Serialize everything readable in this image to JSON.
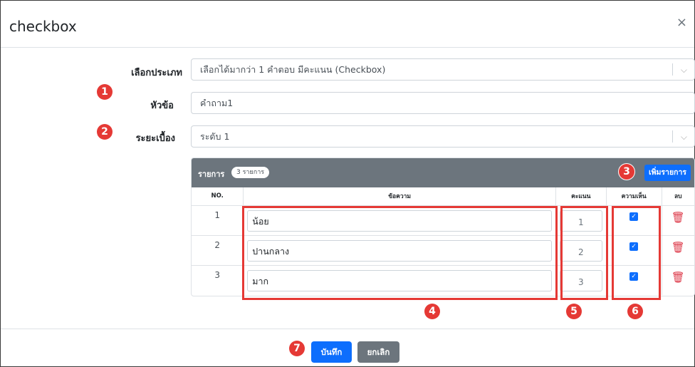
{
  "modal": {
    "title": "checkbox",
    "close_icon": "×"
  },
  "form": {
    "type_label": "เลือกประเภท",
    "type_value": "เลือกได้มากว่า 1 คำตอบ มีคะแนน (Checkbox)",
    "topic_label": "หัวข้อ",
    "topic_value": "คำถาม1",
    "level_label": "ระยะเบื้อง",
    "level_value": "ระดับ 1"
  },
  "items_card": {
    "title": "รายการ",
    "count": "3 รายการ",
    "add_button": "เพิ่มรายการ",
    "headers": [
      "NO.",
      "ข้อความ",
      "คะแนน",
      "ความเห็น",
      "ลบ"
    ],
    "rows": [
      {
        "no": "1",
        "text": "น้อย",
        "score": "1",
        "checked": true
      },
      {
        "no": "2",
        "text": "ปานกลาง",
        "score": "2",
        "checked": true
      },
      {
        "no": "3",
        "text": "มาก",
        "score": "3",
        "checked": true
      }
    ]
  },
  "markers": [
    "1",
    "2",
    "3",
    "4",
    "5",
    "6",
    "7"
  ],
  "footer": {
    "save_label": "บันทึก",
    "cancel_label": "ยกเลิก"
  },
  "colors": {
    "primary": "#0d6efd",
    "secondary": "#6c757d",
    "danger": "#dc3545",
    "annotation": "#e53935"
  },
  "icons": {
    "chevron": "chevron-down-icon",
    "trash": "trash-icon",
    "check": "check-icon"
  }
}
